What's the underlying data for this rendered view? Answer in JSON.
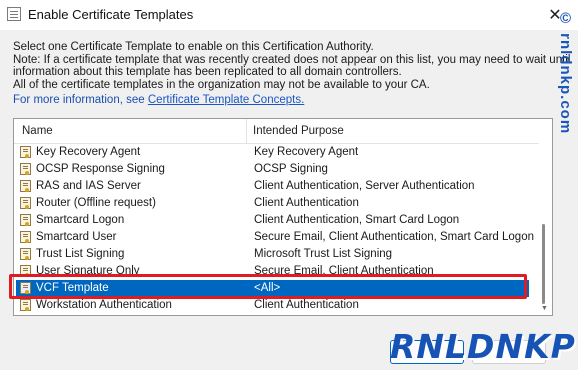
{
  "window": {
    "title": "Enable Certificate Templates",
    "close_glyph": "✕"
  },
  "description": {
    "lines": [
      "Select one Certificate Template to enable on this Certification Authority.",
      "Note: If a certificate template that was recently created does not appear on this list, you may need to wait until",
      "information about this template has been replicated to all domain controllers.",
      "All of the certificate templates in the organization may not be available to your CA."
    ],
    "more_info_prefix": "For more information, see",
    "more_info_link": "Certificate Template Concepts."
  },
  "list": {
    "columns": {
      "name": "Name",
      "purpose": "Intended Purpose"
    },
    "rows": [
      {
        "name": "Key Recovery Agent",
        "purpose": "Key Recovery Agent",
        "icon": "certificate-template-icon"
      },
      {
        "name": "OCSP Response Signing",
        "purpose": "OCSP Signing",
        "icon": "certificate-template-icon"
      },
      {
        "name": "RAS and IAS Server",
        "purpose": "Client Authentication, Server Authentication",
        "icon": "certificate-template-icon"
      },
      {
        "name": "Router (Offline request)",
        "purpose": "Client Authentication",
        "icon": "certificate-template-icon"
      },
      {
        "name": "Smartcard Logon",
        "purpose": "Client Authentication, Smart Card Logon",
        "icon": "certificate-template-icon"
      },
      {
        "name": "Smartcard User",
        "purpose": "Secure Email, Client Authentication, Smart Card Logon",
        "icon": "certificate-template-icon"
      },
      {
        "name": "Trust List Signing",
        "purpose": "Microsoft Trust List Signing",
        "icon": "certificate-template-icon"
      },
      {
        "name": "User Signature Only",
        "purpose": "Secure Email, Client Authentication",
        "icon": "certificate-template-icon"
      },
      {
        "name": "VCF Template",
        "purpose": "<All>",
        "icon": "certificate-template-icon",
        "selected": true
      },
      {
        "name": "Workstation Authentication",
        "purpose": "Client Authentication",
        "icon": "certificate-template-icon"
      }
    ]
  },
  "watermark": {
    "side_text": "© rnldnkp.com",
    "logo_text": "RNLDNKP"
  },
  "colors": {
    "selection": "#0067c0",
    "highlight_border": "#e01b24",
    "link": "#1a56c4",
    "watermark": "#1653b5"
  }
}
